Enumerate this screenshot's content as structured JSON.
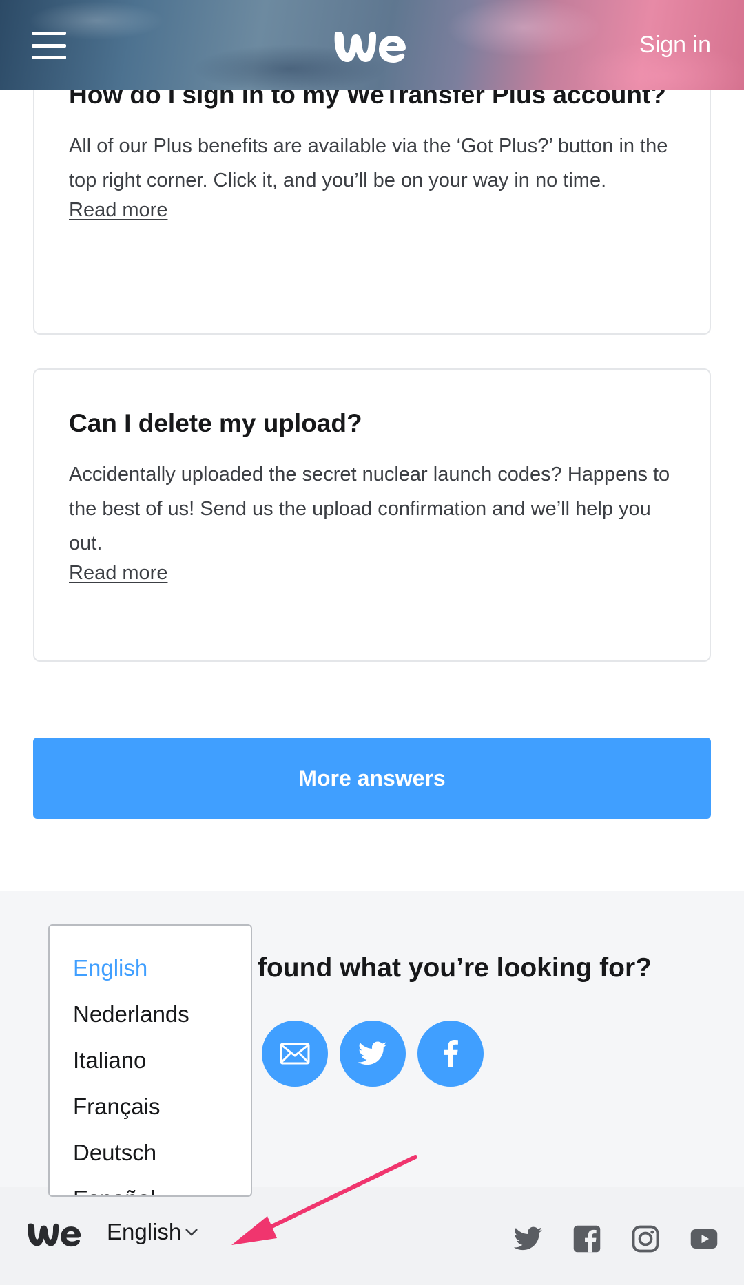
{
  "header": {
    "menu_icon": "hamburger-menu-icon",
    "logo": "we",
    "signin_label": "Sign in"
  },
  "faq": [
    {
      "title": "How do I sign in to my WeTransfer Plus account?",
      "body": "All of our Plus benefits are available via the ‘Got Plus?’ button in the top right corner. Click it, and you’ll be on your way in no time.",
      "link": "Read more"
    },
    {
      "title": "Can I delete my upload?",
      "body": "Accidentally uploaded the secret nuclear launch codes? Happens to the best of us! Send us the upload confirmation and we’ll help you out.",
      "link": "Read more"
    }
  ],
  "more_answers_label": "More answers",
  "help": {
    "title": "found what you’re looking for?",
    "icons": [
      "mail-icon",
      "twitter-icon",
      "facebook-icon"
    ]
  },
  "language_menu": {
    "selected": "English",
    "options": [
      "English",
      "Nederlands",
      "Italiano",
      "Français",
      "Deutsch",
      "Español"
    ]
  },
  "footer": {
    "logo": "we",
    "language": "English",
    "social_icons": [
      "twitter-icon",
      "facebook-icon",
      "instagram-icon",
      "youtube-icon"
    ]
  },
  "colors": {
    "accent": "#409fff",
    "annotation_arrow": "#f0356e"
  }
}
